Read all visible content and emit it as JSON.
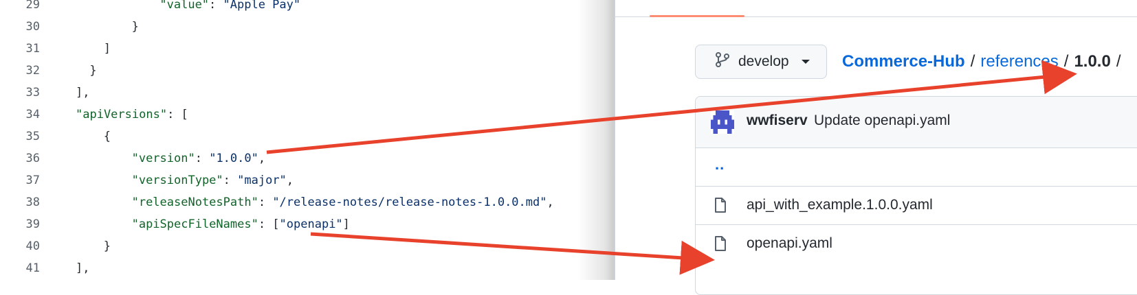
{
  "code": {
    "lines": [
      {
        "n": "29",
        "indent": "      ",
        "parts": [
          {
            "t": "\"value\"",
            "c": "key"
          },
          {
            "t": ": ",
            "c": "punc"
          },
          {
            "t": "\"Apple Pay\"",
            "c": "str"
          }
        ]
      },
      {
        "n": "30",
        "indent": "    ",
        "parts": [
          {
            "t": "}",
            "c": "punc"
          }
        ]
      },
      {
        "n": "31",
        "indent": "  ",
        "parts": [
          {
            "t": "]",
            "c": "punc"
          }
        ]
      },
      {
        "n": "32",
        "indent": " ",
        "parts": [
          {
            "t": "}",
            "c": "punc"
          }
        ]
      },
      {
        "n": "33",
        "indent": "",
        "parts": [
          {
            "t": "],",
            "c": "punc"
          }
        ]
      },
      {
        "n": "34",
        "indent": "",
        "parts": [
          {
            "t": "\"apiVersions\"",
            "c": "key"
          },
          {
            "t": ": [",
            "c": "punc"
          }
        ]
      },
      {
        "n": "35",
        "indent": "  ",
        "parts": [
          {
            "t": "{",
            "c": "punc"
          }
        ]
      },
      {
        "n": "36",
        "indent": "    ",
        "parts": [
          {
            "t": "\"version\"",
            "c": "key"
          },
          {
            "t": ": ",
            "c": "punc"
          },
          {
            "t": "\"1.0.0\"",
            "c": "str"
          },
          {
            "t": ",",
            "c": "punc"
          }
        ]
      },
      {
        "n": "37",
        "indent": "    ",
        "parts": [
          {
            "t": "\"versionType\"",
            "c": "key"
          },
          {
            "t": ": ",
            "c": "punc"
          },
          {
            "t": "\"major\"",
            "c": "str"
          },
          {
            "t": ",",
            "c": "punc"
          }
        ]
      },
      {
        "n": "38",
        "indent": "    ",
        "parts": [
          {
            "t": "\"releaseNotesPath\"",
            "c": "key"
          },
          {
            "t": ": ",
            "c": "punc"
          },
          {
            "t": "\"/release-notes/release-notes-1.0.0.md\"",
            "c": "str"
          },
          {
            "t": ",",
            "c": "punc"
          }
        ]
      },
      {
        "n": "39",
        "indent": "    ",
        "parts": [
          {
            "t": "\"apiSpecFileNames\"",
            "c": "key"
          },
          {
            "t": ": [",
            "c": "punc"
          },
          {
            "t": "\"openapi\"",
            "c": "str"
          },
          {
            "t": "]",
            "c": "punc"
          }
        ]
      },
      {
        "n": "40",
        "indent": "  ",
        "parts": [
          {
            "t": "}",
            "c": "punc"
          }
        ]
      },
      {
        "n": "41",
        "indent": "",
        "parts": [
          {
            "t": "],",
            "c": "punc"
          }
        ]
      }
    ]
  },
  "repo": {
    "branch": "develop",
    "breadcrumb": {
      "repo": "Commerce-Hub",
      "sep1": "/",
      "folder": "references",
      "sep2": "/",
      "current": "1.0.0",
      "sep3": "/"
    },
    "commit": {
      "author": "wwfiserv",
      "message": "Update openapi.yaml"
    },
    "parent_link": "..",
    "files": [
      {
        "name": "api_with_example.1.0.0.yaml"
      },
      {
        "name": "openapi.yaml"
      }
    ]
  },
  "colors": {
    "arrow": "#e8412c",
    "link": "#0969da",
    "key": "#116329",
    "string": "#0a3069",
    "tab_underline": "#fd8c73"
  }
}
